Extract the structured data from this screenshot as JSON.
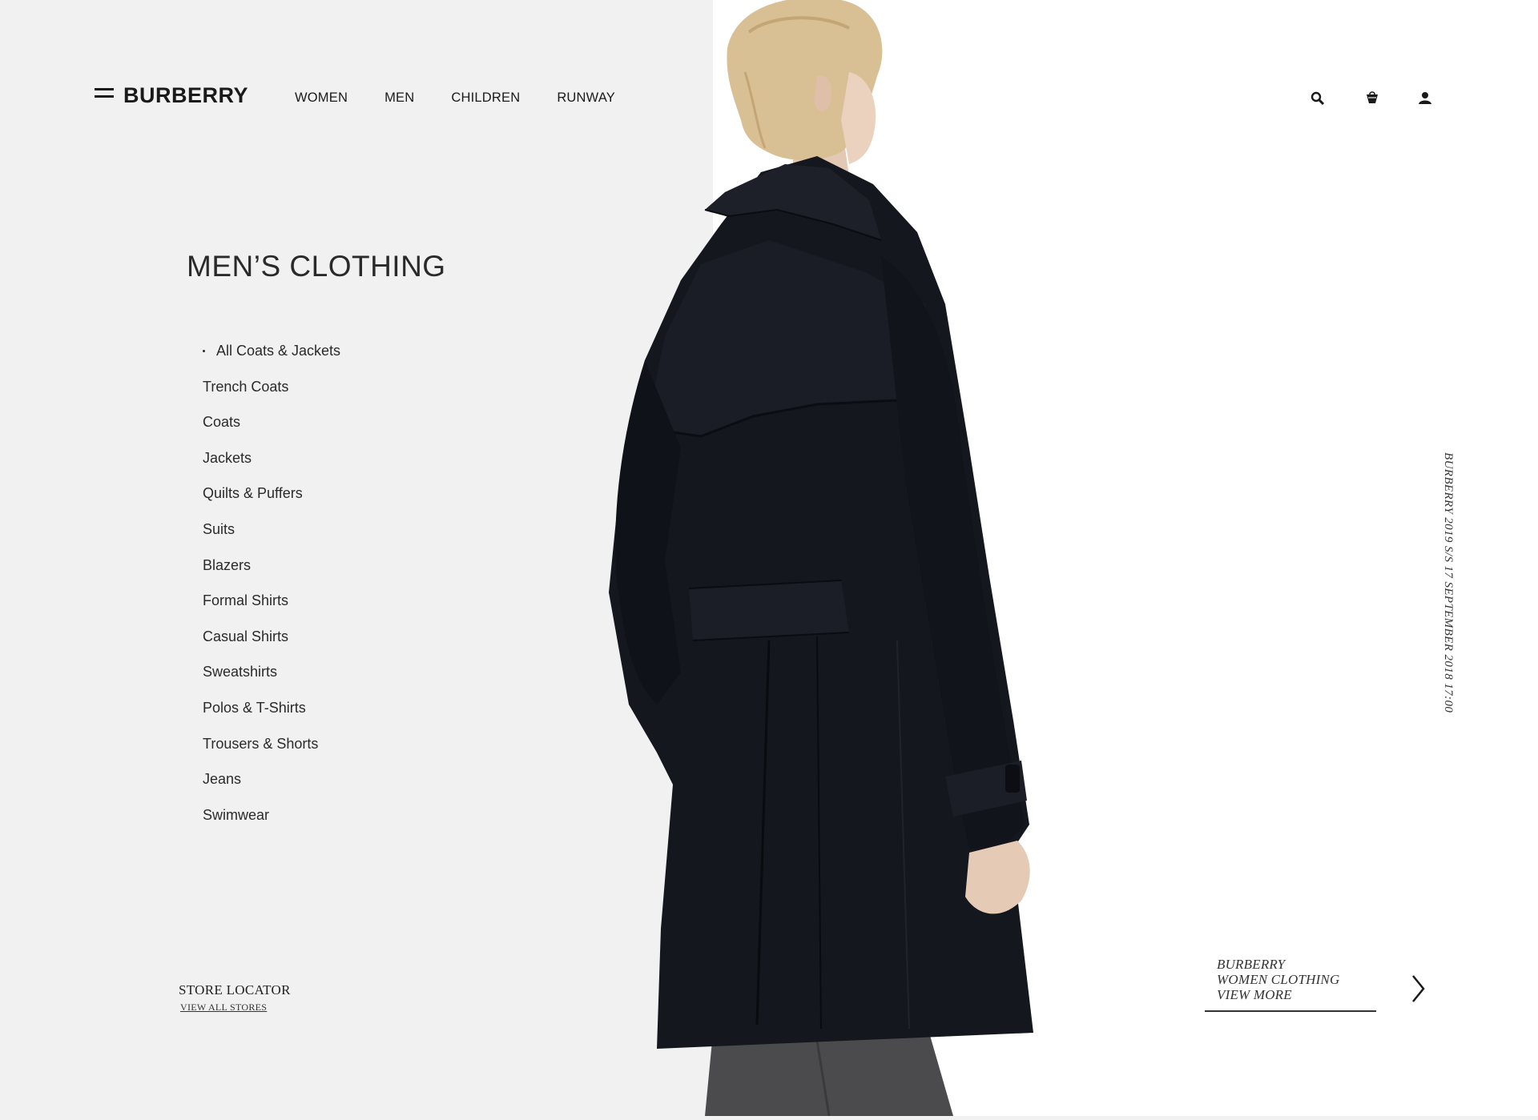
{
  "brand": {
    "logo": "BURBERRY"
  },
  "nav": {
    "items": [
      "WOMEN",
      "MEN",
      "CHILDREN",
      "RUNWAY"
    ]
  },
  "header_icons": [
    "search-icon",
    "shopping-bag-icon",
    "account-icon"
  ],
  "category": {
    "title": "MEN’S CLOTHING",
    "active_index": 0,
    "items": [
      "All Coats & Jackets",
      "Trench Coats",
      "Coats",
      "Jackets",
      "Quilts & Puffers",
      "Suits",
      "Blazers",
      "Formal Shirts",
      "Casual Shirts",
      "Sweatshirts",
      "Polos & T-Shirts",
      "Trousers & Shorts",
      "Jeans",
      "Swimwear"
    ]
  },
  "store": {
    "title": "STORE LOCATOR",
    "link": "VIEW ALL STORES"
  },
  "side_caption": "BURBERRY 2019 S/S 17 SEPTEMBER 2018 17:00",
  "promo": {
    "lines": [
      "BURBERRY",
      "WOMEN CLOTHING",
      "VIEW MORE"
    ]
  },
  "colors": {
    "left_bg": "#f1f1f1",
    "right_bg": "#ffffff",
    "coat": "#15171f",
    "text": "#1a1a1a"
  }
}
